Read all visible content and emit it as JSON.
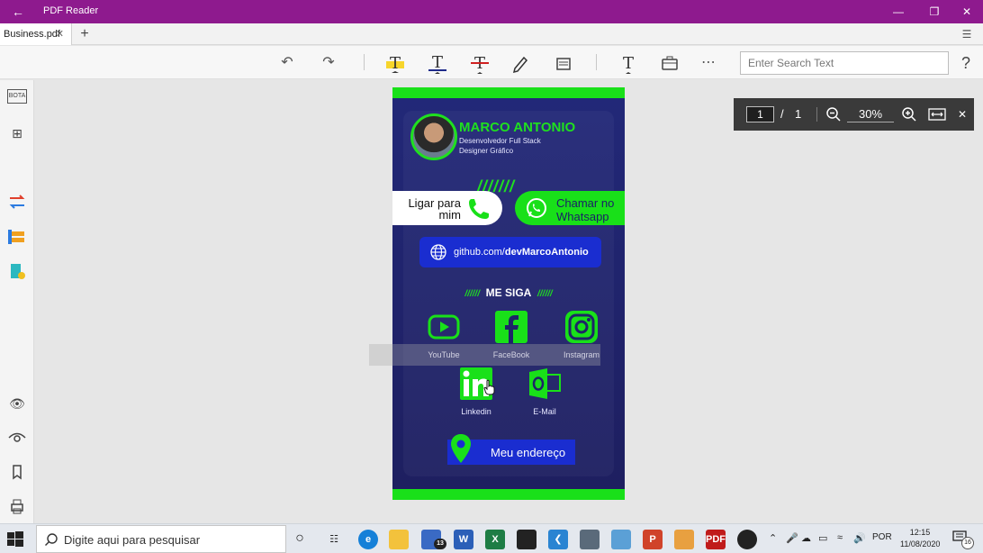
{
  "titlebar": {
    "title": "PDF Reader"
  },
  "tabs": [
    {
      "label": "Business.pdf"
    }
  ],
  "toolbar": {
    "search_placeholder": "Enter Search Text"
  },
  "sidebar": {
    "bota_label": "BOTA"
  },
  "card": {
    "name": "MARCO ANTONIO",
    "role1": "Desenvolvedor Full Stack",
    "role2": "Designer Gráfico",
    "slashes": "///////",
    "call_label": "Ligar para mim",
    "whatsapp_label": "Chamar no Whatsapp",
    "github_prefix": "github.com/",
    "github_user": "devMarcoAntonio",
    "follow_heading": "ME SIGA",
    "follow_deco": "//////",
    "social": [
      {
        "label": "YouTube"
      },
      {
        "label": "FaceBook"
      },
      {
        "label": "Instagram"
      },
      {
        "label": "Linkedin"
      },
      {
        "label": "E-Mail"
      }
    ],
    "address_label": "Meu endereço",
    "accent_color": "#1fe01f",
    "bg_color": "#222878"
  },
  "navigator": {
    "current_page": "1",
    "separator": "/",
    "total_pages": "1",
    "zoom": "30%"
  },
  "taskbar": {
    "search_placeholder": "Digite aqui para pesquisar",
    "mail_badge": "13",
    "language": "POR",
    "time": "12:15",
    "date": "11/08/2020",
    "notification_count": "16"
  }
}
